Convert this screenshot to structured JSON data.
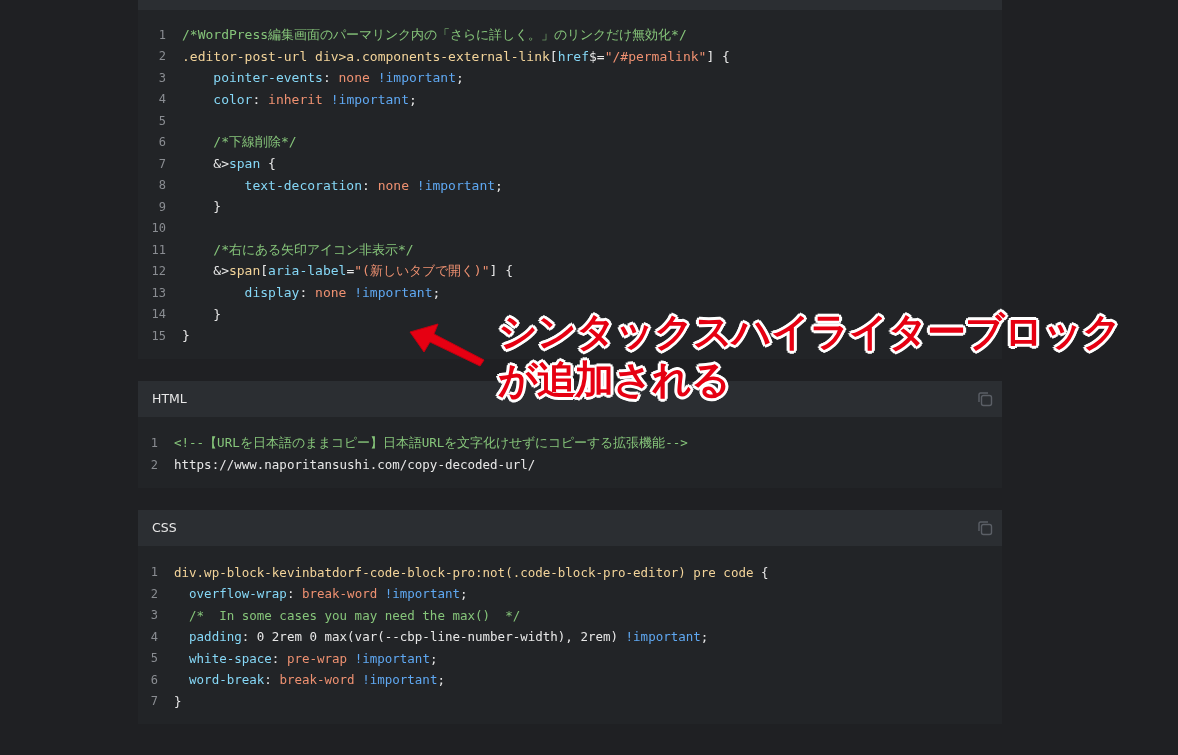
{
  "code_blocks": [
    {
      "copy_button": false,
      "lines": [
        {
          "number": "1",
          "tokens": [
            {
              "kind": "c",
              "text": "/*WordPress編集画面のパーマリンク内の「さらに詳しく。」のリンクだけ無効化*/"
            }
          ]
        },
        {
          "number": "2",
          "tokens": [
            {
              "kind": "s",
              "text": ".editor-post-url div>a.components-external-link"
            },
            {
              "kind": "t",
              "text": "["
            },
            {
              "kind": "p",
              "text": "href"
            },
            {
              "kind": "t",
              "text": "$="
            },
            {
              "kind": "v",
              "text": "\"/#permalink\""
            },
            {
              "kind": "t",
              "text": "] {"
            }
          ]
        },
        {
          "number": "3",
          "tokens": [
            {
              "kind": "p",
              "text": "    pointer-events"
            },
            {
              "kind": "t",
              "text": ": "
            },
            {
              "kind": "v",
              "text": "none"
            },
            {
              "kind": "i",
              "text": " !important"
            },
            {
              "kind": "t",
              "text": ";"
            }
          ]
        },
        {
          "number": "4",
          "tokens": [
            {
              "kind": "p",
              "text": "    color"
            },
            {
              "kind": "t",
              "text": ": "
            },
            {
              "kind": "v",
              "text": "inherit"
            },
            {
              "kind": "i",
              "text": " !important"
            },
            {
              "kind": "t",
              "text": ";"
            }
          ]
        },
        {
          "number": "5"
        },
        {
          "number": "6",
          "tokens": [
            {
              "kind": "c",
              "text": "    /*下線削除*/"
            }
          ]
        },
        {
          "number": "7",
          "tokens": [
            {
              "kind": "t",
              "text": "    &>"
            },
            {
              "kind": "p",
              "text": "span"
            },
            {
              "kind": "t",
              "text": " {"
            }
          ]
        },
        {
          "number": "8",
          "tokens": [
            {
              "kind": "p",
              "text": "        text-decoration"
            },
            {
              "kind": "t",
              "text": ": "
            },
            {
              "kind": "v",
              "text": "none"
            },
            {
              "kind": "i",
              "text": " !important"
            },
            {
              "kind": "t",
              "text": ";"
            }
          ]
        },
        {
          "number": "9",
          "tokens": [
            {
              "kind": "t",
              "text": "    }"
            }
          ]
        },
        {
          "number": "10"
        },
        {
          "number": "11",
          "tokens": [
            {
              "kind": "c",
              "text": "    /*右にある矢印アイコン非表示*/"
            }
          ]
        },
        {
          "number": "12",
          "tokens": [
            {
              "kind": "t",
              "text": "    &>"
            },
            {
              "kind": "s",
              "text": "span"
            },
            {
              "kind": "t",
              "text": "["
            },
            {
              "kind": "p",
              "text": "aria-label"
            },
            {
              "kind": "t",
              "text": "="
            },
            {
              "kind": "v",
              "text": "\"(新しいタブで開く)\""
            },
            {
              "kind": "t",
              "text": "] {"
            }
          ]
        },
        {
          "number": "13",
          "tokens": [
            {
              "kind": "p",
              "text": "        display"
            },
            {
              "kind": "t",
              "text": ": "
            },
            {
              "kind": "v",
              "text": "none"
            },
            {
              "kind": "i",
              "text": " !important"
            },
            {
              "kind": "t",
              "text": ";"
            }
          ]
        },
        {
          "number": "14",
          "tokens": [
            {
              "kind": "t",
              "text": "    }"
            }
          ]
        },
        {
          "number": "15",
          "tokens": [
            {
              "kind": "t",
              "text": "}"
            }
          ]
        }
      ]
    },
    {
      "title": "HTML",
      "copy_button": true,
      "lines": [
        {
          "number": "1",
          "tokens": [
            {
              "kind": "c",
              "text": "<!--【URLを日本語のままコピー】日本語URLを文字化けせずにコピーする拡張機能-->"
            }
          ]
        },
        {
          "number": "2",
          "tokens": [
            {
              "kind": "t",
              "text": "https://www.naporitansushi.com/copy-decoded-url/"
            }
          ]
        }
      ]
    },
    {
      "title": "CSS",
      "copy_button": true,
      "lines": [
        {
          "number": "1",
          "tokens": [
            {
              "kind": "s",
              "text": "div.wp-block-kevinbatdorf-code-block-pro:not(.code-block-pro-editor) pre code"
            },
            {
              "kind": "t",
              "text": " {"
            }
          ]
        },
        {
          "number": "2",
          "tokens": [
            {
              "kind": "p",
              "text": "  overflow-wrap"
            },
            {
              "kind": "t",
              "text": ": "
            },
            {
              "kind": "v",
              "text": "break-word"
            },
            {
              "kind": "i",
              "text": " !important"
            },
            {
              "kind": "t",
              "text": ";"
            }
          ]
        },
        {
          "number": "3",
          "tokens": [
            {
              "kind": "c",
              "text": "  /*  In some cases you may need the max()  */"
            }
          ]
        },
        {
          "number": "4",
          "tokens": [
            {
              "kind": "p",
              "text": "  padding"
            },
            {
              "kind": "t",
              "text": ": 0 2rem 0 max(var(--cbp-line-number-width), 2rem)"
            },
            {
              "kind": "i",
              "text": " !important"
            },
            {
              "kind": "t",
              "text": ";"
            }
          ]
        },
        {
          "number": "5",
          "tokens": [
            {
              "kind": "p",
              "text": "  white-space"
            },
            {
              "kind": "t",
              "text": ": "
            },
            {
              "kind": "v",
              "text": "pre-wrap"
            },
            {
              "kind": "i",
              "text": " !important"
            },
            {
              "kind": "t",
              "text": ";"
            }
          ]
        },
        {
          "number": "6",
          "tokens": [
            {
              "kind": "p",
              "text": "  word-break"
            },
            {
              "kind": "t",
              "text": ": "
            },
            {
              "kind": "v",
              "text": "break-word"
            },
            {
              "kind": "i",
              "text": " !important"
            },
            {
              "kind": "t",
              "text": ";"
            }
          ]
        },
        {
          "number": "7",
          "tokens": [
            {
              "kind": "t",
              "text": "}"
            }
          ]
        }
      ]
    }
  ],
  "annotation": {
    "lines": [
      "シンタックスハイライターブロック",
      "が追加される"
    ]
  }
}
